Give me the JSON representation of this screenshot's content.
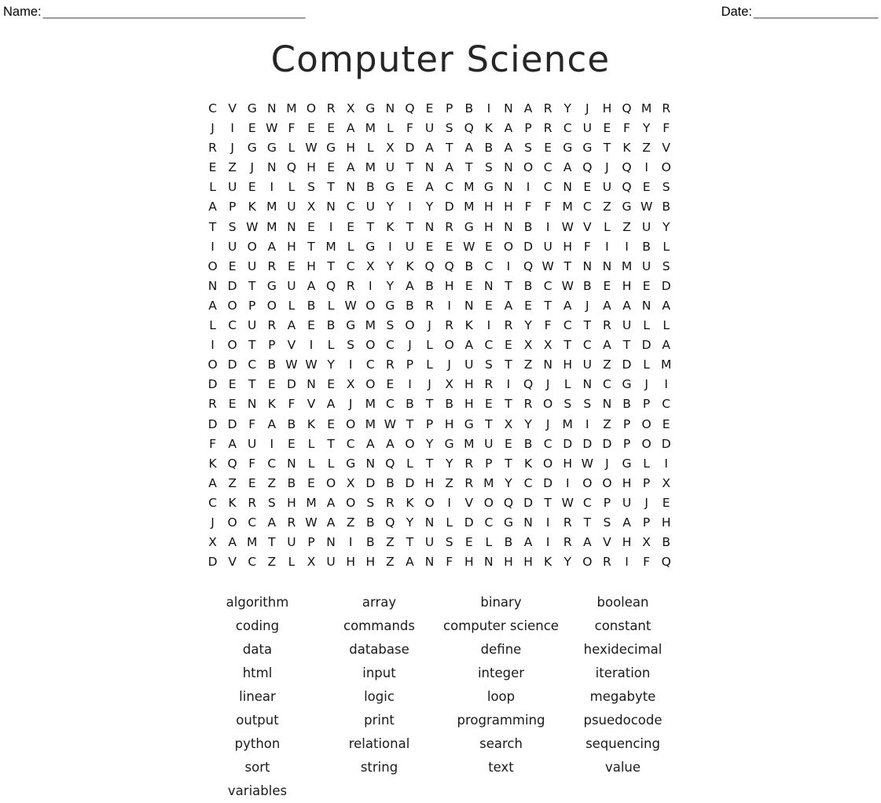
{
  "header": {
    "name_label": "Name:",
    "name_rule": "______________________________________",
    "date_label": "Date:",
    "date_rule": "__________________"
  },
  "title": "Computer Science",
  "grid": {
    "rows": 24,
    "cols": 24,
    "letters": [
      [
        "C",
        "V",
        "G",
        "N",
        "M",
        "O",
        "R",
        "X",
        "G",
        "N",
        "Q",
        "E",
        "P",
        "B",
        "I",
        "N",
        "A",
        "R",
        "Y",
        "J",
        "H",
        "Q",
        "M",
        "R"
      ],
      [
        "J",
        "I",
        "E",
        "W",
        "F",
        "E",
        "E",
        "A",
        "M",
        "L",
        "F",
        "U",
        "S",
        "Q",
        "K",
        "A",
        "P",
        "R",
        "C",
        "U",
        "E",
        "F",
        "Y",
        "F"
      ],
      [
        "R",
        "J",
        "G",
        "G",
        "L",
        "W",
        "G",
        "H",
        "L",
        "X",
        "D",
        "A",
        "T",
        "A",
        "B",
        "A",
        "S",
        "E",
        "G",
        "G",
        "T",
        "K",
        "Z",
        "V"
      ],
      [
        "E",
        "Z",
        "J",
        "N",
        "Q",
        "H",
        "E",
        "A",
        "M",
        "U",
        "T",
        "N",
        "A",
        "T",
        "S",
        "N",
        "O",
        "C",
        "A",
        "Q",
        "J",
        "Q",
        "I",
        "O"
      ],
      [
        "L",
        "U",
        "E",
        "I",
        "L",
        "S",
        "T",
        "N",
        "B",
        "G",
        "E",
        "A",
        "C",
        "M",
        "G",
        "N",
        "I",
        "C",
        "N",
        "E",
        "U",
        "Q",
        "E",
        "S"
      ],
      [
        "A",
        "P",
        "K",
        "M",
        "U",
        "X",
        "N",
        "C",
        "U",
        "Y",
        "I",
        "Y",
        "D",
        "M",
        "H",
        "H",
        "F",
        "F",
        "M",
        "C",
        "Z",
        "G",
        "W",
        "B"
      ],
      [
        "T",
        "S",
        "W",
        "M",
        "N",
        "E",
        "I",
        "E",
        "T",
        "K",
        "T",
        "N",
        "R",
        "G",
        "H",
        "N",
        "B",
        "I",
        "W",
        "V",
        "L",
        "Z",
        "U",
        "Y"
      ],
      [
        "I",
        "U",
        "O",
        "A",
        "H",
        "T",
        "M",
        "L",
        "G",
        "I",
        "U",
        "E",
        "E",
        "W",
        "E",
        "O",
        "D",
        "U",
        "H",
        "F",
        "I",
        "I",
        "B",
        "L"
      ],
      [
        "O",
        "E",
        "U",
        "R",
        "E",
        "H",
        "T",
        "C",
        "X",
        "Y",
        "K",
        "Q",
        "Q",
        "B",
        "C",
        "I",
        "Q",
        "W",
        "T",
        "N",
        "N",
        "M",
        "U",
        "S"
      ],
      [
        "N",
        "D",
        "T",
        "G",
        "U",
        "A",
        "Q",
        "R",
        "I",
        "Y",
        "A",
        "B",
        "H",
        "E",
        "N",
        "T",
        "B",
        "C",
        "W",
        "B",
        "E",
        "H",
        "E",
        "D"
      ],
      [
        "A",
        "O",
        "P",
        "O",
        "L",
        "B",
        "L",
        "W",
        "O",
        "G",
        "B",
        "R",
        "I",
        "N",
        "E",
        "A",
        "E",
        "T",
        "A",
        "J",
        "A",
        "A",
        "N",
        "A"
      ],
      [
        "L",
        "C",
        "U",
        "R",
        "A",
        "E",
        "B",
        "G",
        "M",
        "S",
        "O",
        "J",
        "R",
        "K",
        "I",
        "R",
        "Y",
        "F",
        "C",
        "T",
        "R",
        "U",
        "L",
        "L"
      ],
      [
        "I",
        "O",
        "T",
        "P",
        "V",
        "I",
        "L",
        "S",
        "O",
        "C",
        "J",
        "L",
        "O",
        "A",
        "C",
        "E",
        "X",
        "X",
        "T",
        "C",
        "A",
        "T",
        "D",
        "A"
      ],
      [
        "O",
        "D",
        "C",
        "B",
        "W",
        "W",
        "Y",
        "I",
        "C",
        "R",
        "P",
        "L",
        "J",
        "U",
        "S",
        "T",
        "Z",
        "N",
        "H",
        "U",
        "Z",
        "D",
        "L",
        "M"
      ],
      [
        "D",
        "E",
        "T",
        "E",
        "D",
        "N",
        "E",
        "X",
        "O",
        "E",
        "I",
        "J",
        "X",
        "H",
        "R",
        "I",
        "Q",
        "J",
        "L",
        "N",
        "C",
        "G",
        "J",
        "I"
      ],
      [
        "R",
        "E",
        "N",
        "K",
        "F",
        "V",
        "A",
        "J",
        "M",
        "C",
        "B",
        "T",
        "B",
        "H",
        "E",
        "T",
        "R",
        "O",
        "S",
        "S",
        "N",
        "B",
        "P",
        "C"
      ],
      [
        "D",
        "D",
        "F",
        "A",
        "B",
        "K",
        "E",
        "O",
        "M",
        "W",
        "T",
        "P",
        "H",
        "G",
        "T",
        "X",
        "Y",
        "J",
        "M",
        "I",
        "Z",
        "P",
        "O",
        "E"
      ],
      [
        "F",
        "A",
        "U",
        "I",
        "E",
        "L",
        "T",
        "C",
        "A",
        "A",
        "O",
        "Y",
        "G",
        "M",
        "U",
        "E",
        "B",
        "C",
        "D",
        "D",
        "D",
        "P",
        "O",
        "D"
      ],
      [
        "K",
        "Q",
        "F",
        "C",
        "N",
        "L",
        "L",
        "G",
        "N",
        "Q",
        "L",
        "T",
        "Y",
        "R",
        "P",
        "T",
        "K",
        "O",
        "H",
        "W",
        "J",
        "G",
        "L",
        "I"
      ],
      [
        "A",
        "Z",
        "E",
        "Z",
        "B",
        "E",
        "O",
        "X",
        "D",
        "B",
        "D",
        "H",
        "Z",
        "R",
        "M",
        "Y",
        "C",
        "D",
        "I",
        "O",
        "O",
        "H",
        "P",
        "X"
      ],
      [
        "C",
        "K",
        "R",
        "S",
        "H",
        "M",
        "A",
        "O",
        "S",
        "R",
        "K",
        "O",
        "I",
        "V",
        "O",
        "Q",
        "D",
        "T",
        "W",
        "C",
        "P",
        "U",
        "J",
        "E"
      ],
      [
        "J",
        "O",
        "C",
        "A",
        "R",
        "W",
        "A",
        "Z",
        "B",
        "Q",
        "Y",
        "N",
        "L",
        "D",
        "C",
        "G",
        "N",
        "I",
        "R",
        "T",
        "S",
        "A",
        "P",
        "H"
      ],
      [
        "X",
        "A",
        "M",
        "T",
        "U",
        "P",
        "N",
        "I",
        "B",
        "Z",
        "T",
        "U",
        "S",
        "E",
        "L",
        "B",
        "A",
        "I",
        "R",
        "A",
        "V",
        "H",
        "X",
        "B"
      ],
      [
        "D",
        "V",
        "C",
        "Z",
        "L",
        "X",
        "U",
        "H",
        "H",
        "Z",
        "A",
        "N",
        "F",
        "H",
        "N",
        "H",
        "H",
        "K",
        "Y",
        "O",
        "R",
        "I",
        "F",
        "Q"
      ]
    ]
  },
  "wordlist": {
    "columns": 4,
    "rows": [
      [
        "algorithm",
        "array",
        "binary",
        "boolean"
      ],
      [
        "coding",
        "commands",
        "computer science",
        "constant"
      ],
      [
        "data",
        "database",
        "define",
        "hexidecimal"
      ],
      [
        "html",
        "input",
        "integer",
        "iteration"
      ],
      [
        "linear",
        "logic",
        "loop",
        "megabyte"
      ],
      [
        "output",
        "print",
        "programming",
        "psuedocode"
      ],
      [
        "python",
        "relational",
        "search",
        "sequencing"
      ],
      [
        "sort",
        "string",
        "text",
        "value"
      ],
      [
        "variables",
        "",
        "",
        ""
      ]
    ],
    "words": [
      "algorithm",
      "array",
      "binary",
      "boolean",
      "coding",
      "commands",
      "computer science",
      "constant",
      "data",
      "database",
      "define",
      "hexidecimal",
      "html",
      "input",
      "integer",
      "iteration",
      "linear",
      "logic",
      "loop",
      "megabyte",
      "output",
      "print",
      "programming",
      "psuedocode",
      "python",
      "relational",
      "search",
      "sequencing",
      "sort",
      "string",
      "text",
      "value",
      "variables"
    ]
  }
}
